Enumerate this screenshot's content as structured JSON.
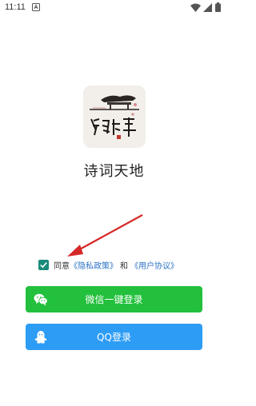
{
  "status_bar": {
    "time": "11:11"
  },
  "app": {
    "name": "诗词天地",
    "logo_text": "诗词中华"
  },
  "agreement": {
    "checked": true,
    "prefix": "同意",
    "privacy_link": "《隐私政策》",
    "and": "和",
    "terms_link": "《用户协议》"
  },
  "buttons": {
    "wechat_label": "微信一键登录",
    "qq_label": "QQ登录"
  },
  "colors": {
    "wechat": "#22c03c",
    "qq": "#2d9cf5",
    "checkbox": "#1a8a7a",
    "link": "#2b73c6",
    "arrow": "#d62828"
  }
}
